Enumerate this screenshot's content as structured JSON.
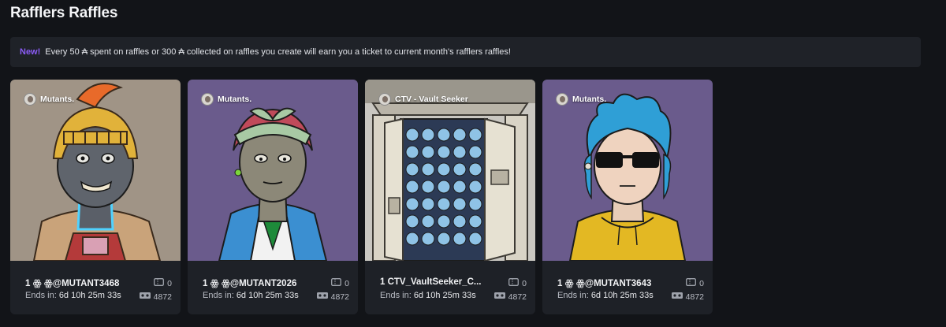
{
  "page": {
    "title": "Rafflers Raffles"
  },
  "banner": {
    "badge": "New!",
    "message": "Every 50 ₳ spent on raffles or 300 ₳ collected on raffles you create will earn you a ticket to current month's rafflers raffles!"
  },
  "raffles": [
    {
      "collection": "Mutants.",
      "name": "1 ꙮ ꙮ@MUTANT3468",
      "ends_label": "Ends in:",
      "ends_value": "6d 10h 25m 33s",
      "tickets": "0",
      "supply": "4872",
      "art": "mutant-gladiator-helmet",
      "bg_color": "#a09486"
    },
    {
      "collection": "Mutants.",
      "name": "1 ꙮ ꙮ@MUTANT2026",
      "ends_label": "Ends in:",
      "ends_value": "6d 10h 25m 33s",
      "tickets": "0",
      "supply": "4872",
      "art": "mutant-headband",
      "bg_color": "#6a5b8c"
    },
    {
      "collection": "CTV - Vault Seeker",
      "name": "1 CTV_VaultSeeker_C...",
      "ends_label": "Ends in:",
      "ends_value": "6d 10h 25m 33s",
      "tickets": "0",
      "supply": "4872",
      "art": "vault-door",
      "bg_color": "#c9c7c1"
    },
    {
      "collection": "Mutants.",
      "name": "1 ꙮ ꙮ@MUTANT3643",
      "ends_label": "Ends in:",
      "ends_value": "6d 10h 25m 33s",
      "tickets": "0",
      "supply": "4872",
      "art": "mutant-sunglasses-hoodie",
      "bg_color": "#6a5b8c"
    }
  ]
}
